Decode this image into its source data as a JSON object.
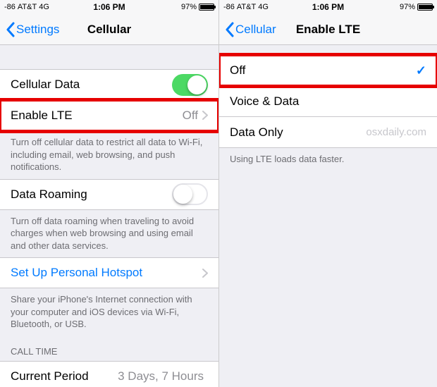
{
  "left": {
    "status": {
      "signal": "-86",
      "carrier": "AT&T",
      "network": "4G",
      "time": "1:06 PM",
      "battery": "97%"
    },
    "nav": {
      "back": "Settings",
      "title": "Cellular"
    },
    "cellular_data_label": "Cellular Data",
    "enable_lte_label": "Enable LTE",
    "enable_lte_value": "Off",
    "cellular_footer": "Turn off cellular data to restrict all data to Wi-Fi, including email, web browsing, and push notifications.",
    "data_roaming_label": "Data Roaming",
    "roaming_footer": "Turn off data roaming when traveling to avoid charges when web browsing and using email and other data services.",
    "hotspot_label": "Set Up Personal Hotspot",
    "hotspot_footer": "Share your iPhone's Internet connection with your computer and iOS devices via Wi-Fi, Bluetooth, or USB.",
    "calltime_header": "CALL TIME",
    "current_period_label": "Current Period",
    "current_period_value": "3 Days, 7 Hours"
  },
  "right": {
    "status": {
      "signal": "-86",
      "carrier": "AT&T",
      "network": "4G",
      "time": "1:06 PM",
      "battery": "97%"
    },
    "nav": {
      "back": "Cellular",
      "title": "Enable LTE"
    },
    "options": {
      "off": "Off",
      "voice_data": "Voice & Data",
      "data_only": "Data Only"
    },
    "watermark": "osxdaily.com",
    "footer": "Using LTE loads data faster."
  }
}
